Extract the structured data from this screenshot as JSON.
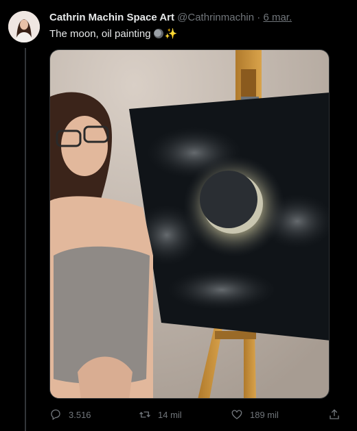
{
  "tweet": {
    "author_name": "Cathrin Machin Space Art",
    "handle": "@Cathrinmachin",
    "separator": "·",
    "time": "6 mar.",
    "text": "The moon, oil painting",
    "emoji": [
      "moon-emoji",
      "sparkles-emoji"
    ]
  },
  "media": {
    "alt": "Woman standing next to an oil painting of the moon on an easel"
  },
  "actions": {
    "reply_count": "3.516",
    "retweet_count": "14 mil",
    "like_count": "189 mil"
  },
  "colors": {
    "background": "#000000",
    "text": "#e7e9ea",
    "muted": "#71767b",
    "border": "#2f3336"
  }
}
